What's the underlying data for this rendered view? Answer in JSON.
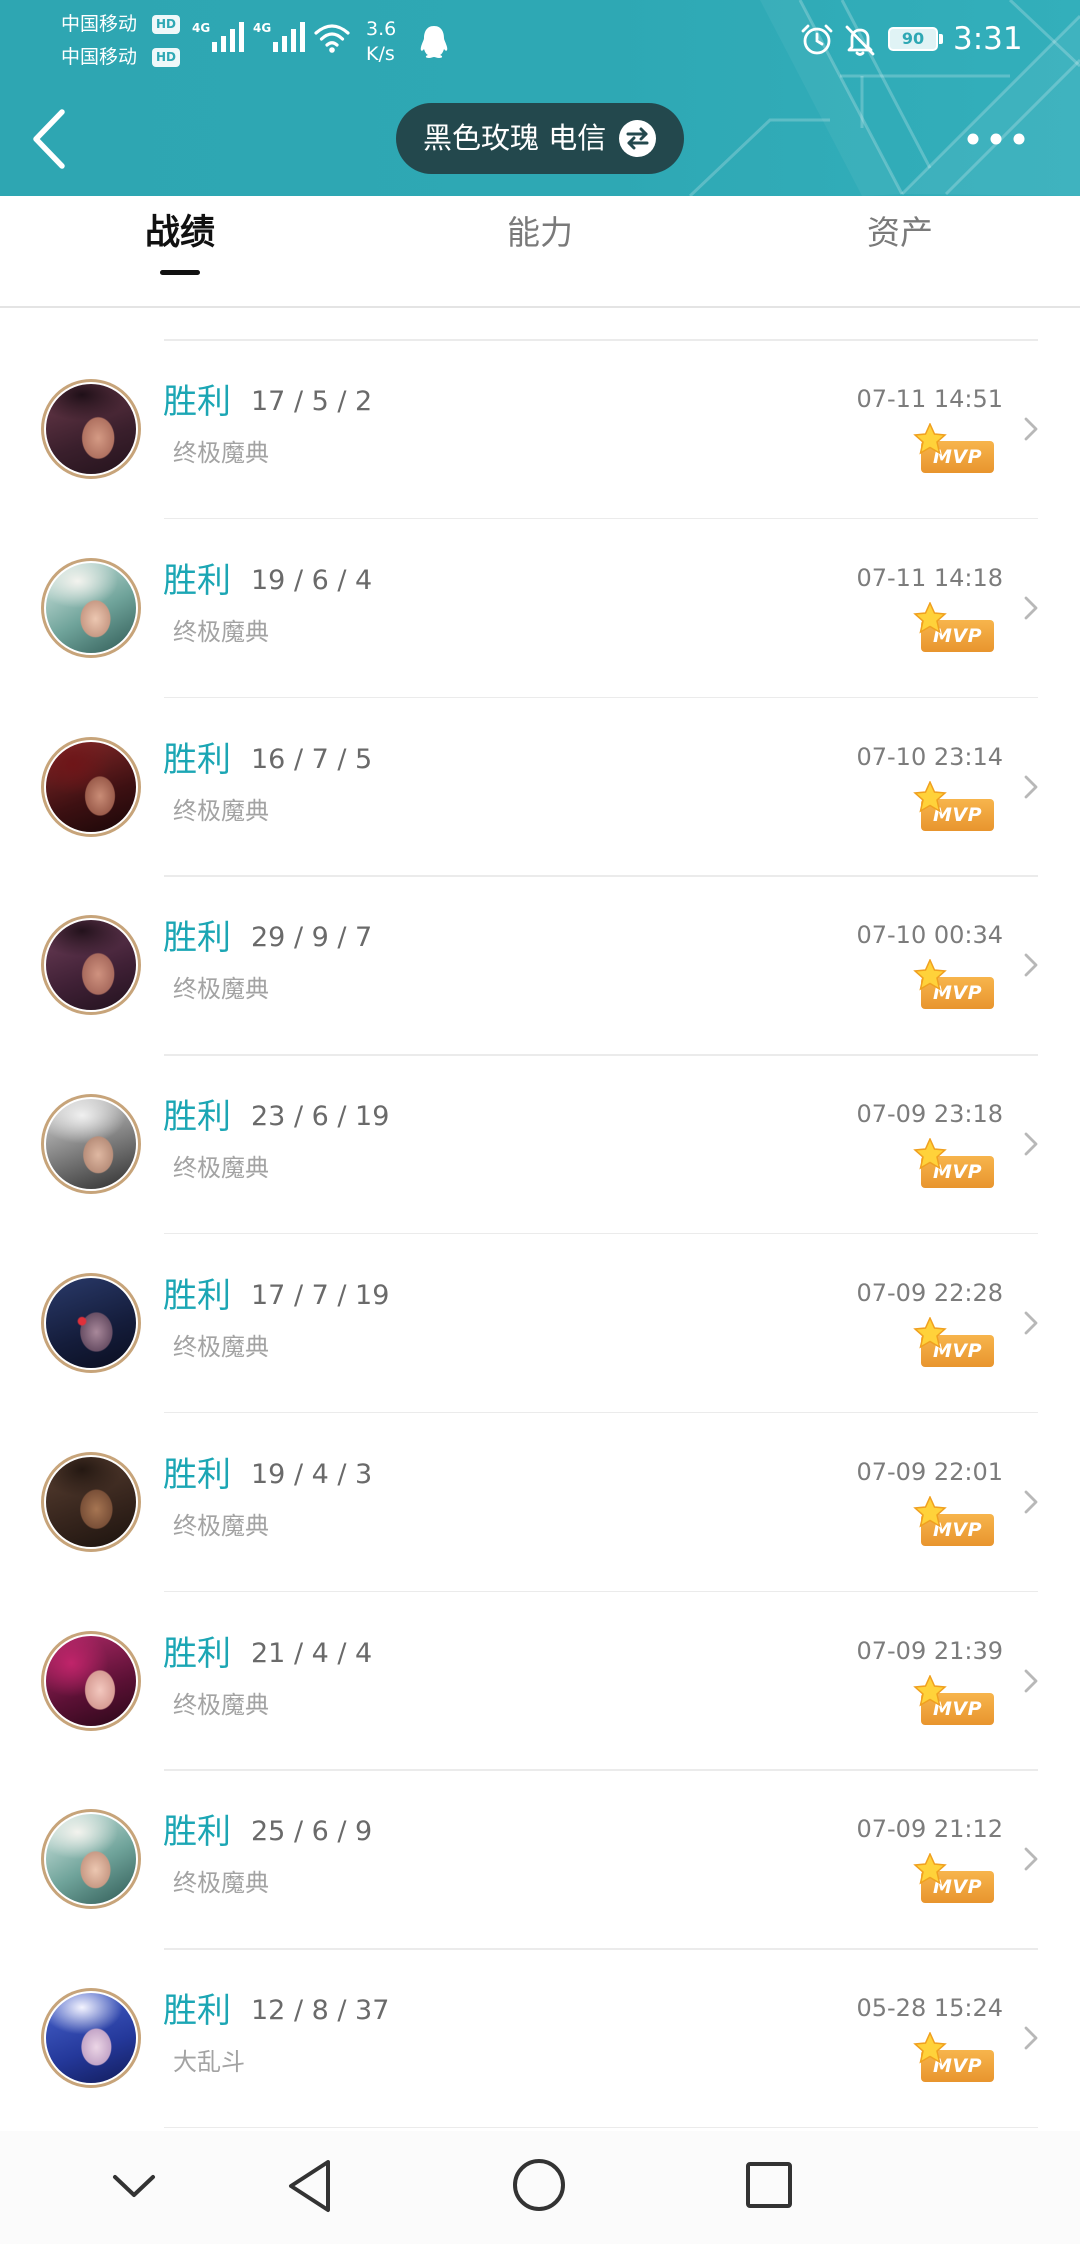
{
  "status_bar": {
    "carrier_1": "中国移动",
    "hd_1": "HD",
    "carrier_2": "中国移动",
    "hd_2": "HD",
    "signal_1_type": "4G",
    "signal_2_type": "4G",
    "speed_value": "3.6",
    "speed_unit": "K/s",
    "battery_level": "90",
    "time": "3:31",
    "icons": [
      "signal-icon",
      "wifi-icon",
      "qq-icon",
      "alarm-icon",
      "bell-off-icon",
      "battery-icon"
    ]
  },
  "header": {
    "title": "黑色玫瑰 电信",
    "icons": {
      "back": "chevron-left-icon",
      "switch": "swap-icon",
      "more": "more-dots-icon"
    }
  },
  "tabs": [
    {
      "label": "战绩",
      "active": true
    },
    {
      "label": "能力",
      "active": false
    },
    {
      "label": "资产",
      "active": false
    }
  ],
  "matches": [
    {
      "result": "胜利",
      "kda": "17 / 5 / 2",
      "mode": "终极魔典",
      "time": "07-11 14:51",
      "badge": "MVP"
    },
    {
      "result": "胜利",
      "kda": "19 / 6 / 4",
      "mode": "终极魔典",
      "time": "07-11 14:18",
      "badge": "MVP"
    },
    {
      "result": "胜利",
      "kda": "16 / 7 / 5",
      "mode": "终极魔典",
      "time": "07-10 23:14",
      "badge": "MVP"
    },
    {
      "result": "胜利",
      "kda": "29 / 9 / 7",
      "mode": "终极魔典",
      "time": "07-10 00:34",
      "badge": "MVP"
    },
    {
      "result": "胜利",
      "kda": "23 / 6 / 19",
      "mode": "终极魔典",
      "time": "07-09 23:18",
      "badge": "MVP"
    },
    {
      "result": "胜利",
      "kda": "17 / 7 / 19",
      "mode": "终极魔典",
      "time": "07-09 22:28",
      "badge": "MVP"
    },
    {
      "result": "胜利",
      "kda": "19 / 4 / 3",
      "mode": "终极魔典",
      "time": "07-09 22:01",
      "badge": "MVP"
    },
    {
      "result": "胜利",
      "kda": "21 / 4 / 4",
      "mode": "终极魔典",
      "time": "07-09 21:39",
      "badge": "MVP"
    },
    {
      "result": "胜利",
      "kda": "25 / 6 / 9",
      "mode": "终极魔典",
      "time": "07-09 21:12",
      "badge": "MVP"
    },
    {
      "result": "胜利",
      "kda": "12 / 8 / 37",
      "mode": "大乱斗",
      "time": "05-28 15:24",
      "badge": "MVP"
    }
  ],
  "nav_bar": {
    "icons": [
      "chevron-down-icon",
      "back-triangle-icon",
      "home-circle-icon",
      "recents-square-icon"
    ]
  },
  "colors": {
    "header_bg": "#2ea8b4",
    "title_pill_bg": "#23484d",
    "win_text": "#1ba6b4",
    "mvp_badge": "#ee9f36",
    "tab_active": "#111111",
    "tab_inactive": "#7a7a7a"
  }
}
